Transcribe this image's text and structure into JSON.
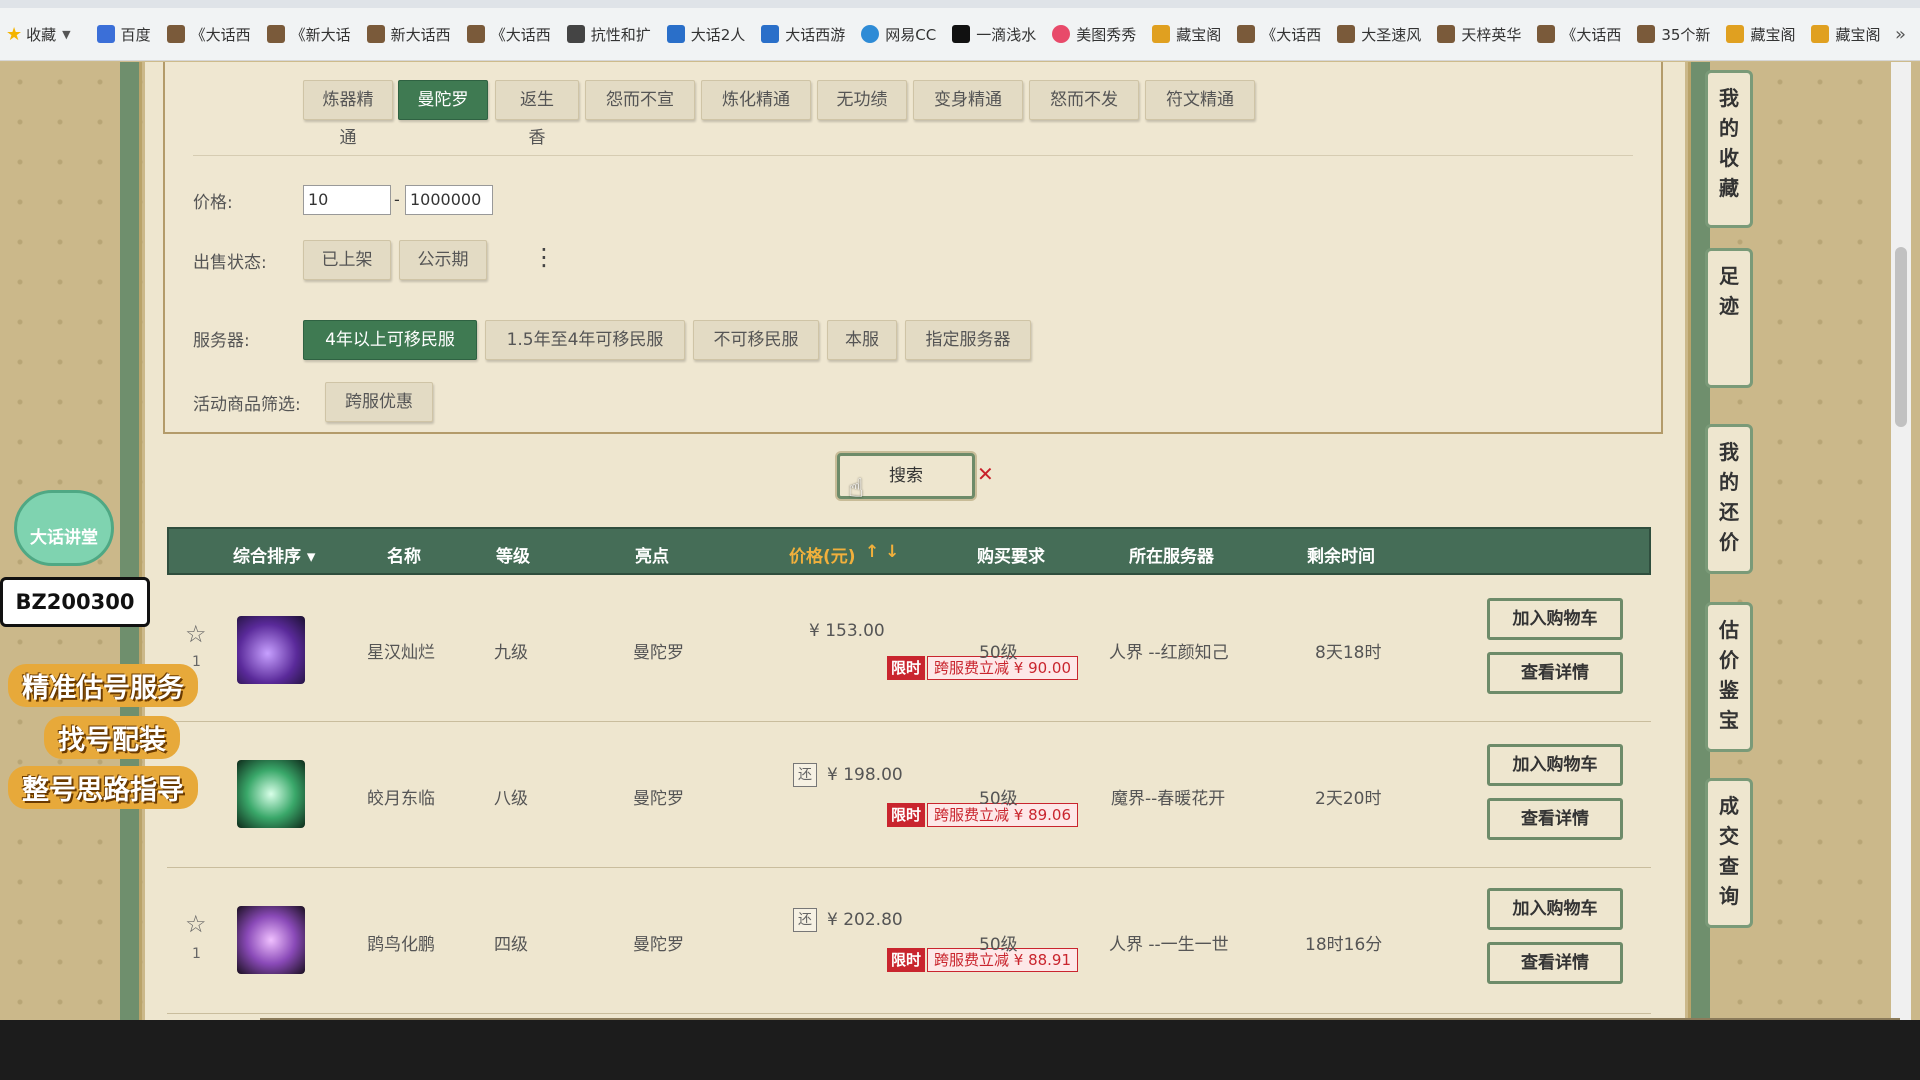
{
  "bookmarks": {
    "items": [
      "收藏",
      "百度",
      "《大话西",
      "《新大话",
      "新大话西",
      "《大话西",
      "抗性和扩",
      "大话2人",
      "大话西游",
      "网易CC",
      "一滴浅水",
      "美图秀秀",
      "藏宝阁",
      "《大话西",
      "大圣速风",
      "天梓英华",
      "《大话西",
      "35个新",
      "藏宝阁",
      "藏宝阁"
    ],
    "more": "»"
  },
  "filters": {
    "category_buttons": [
      "炼器精通",
      "曼陀罗",
      "返生香",
      "怨而不宣",
      "炼化精通",
      "无功绩",
      "变身精通",
      "怒而不发",
      "符文精通"
    ],
    "price_label": "价格:",
    "price_min": "10",
    "price_max": "1000000",
    "price_dash": "-",
    "sale_status_label": "出售状态:",
    "sale_status_options": [
      "已上架",
      "公示期"
    ],
    "more_dots": "⋮",
    "server_label": "服务器:",
    "server_options": [
      "4年以上可移民服",
      "1.5年至4年可移民服",
      "不可移民服",
      "本服",
      "指定服务器"
    ],
    "activity_label": "活动商品筛选:",
    "activity_option": "跨服优惠"
  },
  "search_button": "搜索",
  "table": {
    "headers": {
      "sort": "综合排序 ▾",
      "name": "名称",
      "level": "等级",
      "highlight": "亮点",
      "price": "价格(元)",
      "price_arrows": "↑ ↓",
      "requirement": "购买要求",
      "server": "所在服务器",
      "remaining": "剩余时间"
    },
    "rows": [
      {
        "index": "1",
        "name": "星汉灿烂",
        "level": "九级",
        "highlight": "曼陀罗",
        "price": "¥ 153.00",
        "limit_tag": "限时",
        "limit_text": "跨服费立减 ¥ 90.00",
        "requirement": "50级",
        "server": "人界 --红颜知己",
        "remaining": "8天18时",
        "add_cart": "加入购物车",
        "detail": "查看详情"
      },
      {
        "index": "",
        "name": "皎月东临",
        "level": "八级",
        "highlight": "曼陀罗",
        "bargain": "还",
        "price": "¥ 198.00",
        "limit_tag": "限时",
        "limit_text": "跨服费立减 ¥ 89.06",
        "requirement": "50级",
        "server": "魔界--春暖花开",
        "remaining": "2天20时",
        "add_cart": "加入购物车",
        "detail": "查看详情"
      },
      {
        "index": "1",
        "name": "鹍鸟化鹏",
        "level": "四级",
        "highlight": "曼陀罗",
        "bargain": "还",
        "price": "¥ 202.80",
        "limit_tag": "限时",
        "limit_text": "跨服费立减 ¥ 88.91",
        "requirement": "50级",
        "server": "人界 --一生一世",
        "remaining": "18时16分",
        "add_cart": "加入购物车",
        "detail": "查看详情"
      }
    ]
  },
  "side_tabs": [
    "我的收藏",
    "足迹",
    "我的还价",
    "估价鉴宝",
    "成交查询"
  ],
  "overlay": {
    "badge": "大话讲堂",
    "code": "BZ200300",
    "promo_lines": [
      "精准估号服务",
      "找号配装",
      "整号思路指导"
    ]
  },
  "colors": {
    "accent_green": "#3f7a52",
    "header_green": "#456d57",
    "price_orange": "#f1b03c",
    "limit_red": "#c9252e"
  }
}
